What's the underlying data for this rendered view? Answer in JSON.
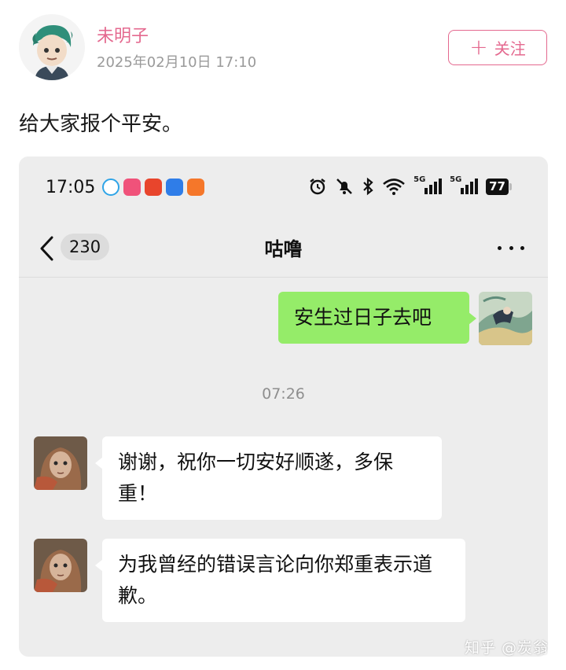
{
  "post": {
    "author": "未明子",
    "timestamp": "2025年02月10日 17:10",
    "follow_label": "关注",
    "text": "给大家报个平安。"
  },
  "phone": {
    "status_bar": {
      "time": "17:05",
      "battery": "77",
      "network_1": "5G",
      "network_2": "5G"
    },
    "nav": {
      "unread_count": "230",
      "title": "咕噜"
    },
    "messages": [
      {
        "side": "out",
        "text": "安生过日子去吧"
      },
      {
        "side": "time",
        "text": "07:26"
      },
      {
        "side": "in",
        "text": "谢谢，祝你一切安好顺遂，多保重！"
      },
      {
        "side": "in",
        "text": "为我曾经的错误言论向你郑重表示道歉。"
      }
    ]
  },
  "watermark": "知乎 @炭翁",
  "colors": {
    "accent_pink": "#e4698f",
    "outgoing_bubble": "#95ec69",
    "incoming_bubble": "#ffffff",
    "chat_background": "#ededed"
  },
  "icons": [
    "plus-icon",
    "back-icon",
    "more-icon",
    "alarm-icon",
    "mute-icon",
    "bluetooth-icon",
    "wifi-icon",
    "signal-icon",
    "battery-icon"
  ]
}
